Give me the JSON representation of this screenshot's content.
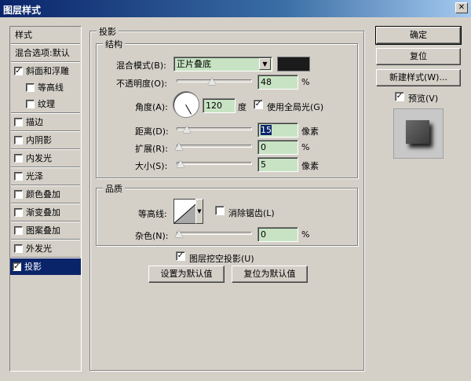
{
  "window": {
    "title": "图层样式",
    "close_glyph": "✕"
  },
  "sidebar": {
    "header": "样式",
    "blend_options": "混合选项:默认",
    "items": [
      {
        "label": "斜面和浮雕",
        "checked": true
      },
      {
        "label": "等高线",
        "checked": false
      },
      {
        "label": "纹理",
        "checked": false
      },
      {
        "label": "描边",
        "checked": false
      },
      {
        "label": "内阴影",
        "checked": false
      },
      {
        "label": "内发光",
        "checked": false
      },
      {
        "label": "光泽",
        "checked": false
      },
      {
        "label": "颜色叠加",
        "checked": false
      },
      {
        "label": "渐变叠加",
        "checked": false
      },
      {
        "label": "图案叠加",
        "checked": false
      },
      {
        "label": "外发光",
        "checked": false
      },
      {
        "label": "投影",
        "checked": true,
        "selected": true
      }
    ]
  },
  "panel": {
    "title": "投影",
    "structure": {
      "title": "结构",
      "blend_mode_label": "混合模式(B):",
      "blend_mode_value": "正片叠底",
      "opacity_label": "不透明度(O):",
      "opacity_value": "48",
      "opacity_unit": "%",
      "opacity_fraction": 0.48,
      "angle_label": "角度(A):",
      "angle_value": "120",
      "angle_unit": "度",
      "global_light_label": "使用全局光(G)",
      "global_light_checked": true,
      "distance_label": "距离(D):",
      "distance_value": "15",
      "distance_unit": "像素",
      "spread_label": "扩展(R):",
      "spread_value": "0",
      "spread_unit": "%",
      "size_label": "大小(S):",
      "size_value": "5",
      "size_unit": "像素"
    },
    "quality": {
      "title": "品质",
      "contour_label": "等高线:",
      "antialias_label": "消除锯齿(L)",
      "antialias_checked": false,
      "noise_label": "杂色(N):",
      "noise_value": "0",
      "noise_unit": "%"
    },
    "knockout_label": "图层挖空投影(U)",
    "knockout_checked": true,
    "set_default": "设置为默认值",
    "reset_default": "复位为默认值"
  },
  "buttons": {
    "ok": "确定",
    "reset": "复位",
    "new_style": "新建样式(W)...",
    "preview_label": "预览(V)",
    "preview_checked": true
  },
  "colors": {
    "shadow": "#1b1b1b",
    "field_bg": "#c7e3c3",
    "selection": "#0a246a"
  }
}
